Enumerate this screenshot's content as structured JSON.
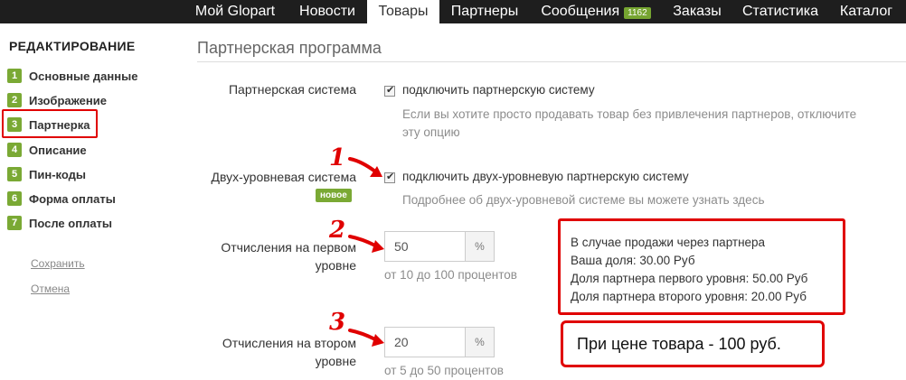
{
  "nav": [
    {
      "label": "Мой Glopart",
      "active": false
    },
    {
      "label": "Новости",
      "active": false
    },
    {
      "label": "Товары",
      "active": true
    },
    {
      "label": "Партнеры",
      "active": false
    },
    {
      "label": "Сообщения",
      "active": false,
      "badge": "1162"
    },
    {
      "label": "Заказы",
      "active": false
    },
    {
      "label": "Статистика",
      "active": false
    },
    {
      "label": "Каталог",
      "active": false
    }
  ],
  "sidebar": {
    "title": "РЕДАКТИРОВАНИЕ",
    "selected_index": 2,
    "items": [
      {
        "num": "1",
        "label": "Основные данные"
      },
      {
        "num": "2",
        "label": "Изображение"
      },
      {
        "num": "3",
        "label": "Партнерка"
      },
      {
        "num": "4",
        "label": "Описание"
      },
      {
        "num": "5",
        "label": "Пин-коды"
      },
      {
        "num": "6",
        "label": "Форма оплаты"
      },
      {
        "num": "7",
        "label": "После оплаты"
      }
    ],
    "save_label": "Сохранить",
    "cancel_label": "Отмена"
  },
  "main": {
    "section_title": "Партнерская программа",
    "partner_system": {
      "label": "Партнерская система",
      "checkbox_label": "подключить партнерскую систему",
      "checked": true,
      "help_line1": "Если вы хотите просто продавать товар без привлечения партнеров, отключите",
      "help_line2": "эту опцию"
    },
    "two_level": {
      "label": "Двух-уровневая система",
      "badge": "новое",
      "checkbox_label": "подключить двух-уровневую партнерскую систему",
      "checked": true,
      "help": "Подробнее об двух-уровневой системе вы можете узнать здесь"
    },
    "first_level": {
      "label_line1": "Отчисления на первом",
      "label_line2": "уровне",
      "value": "50",
      "addon": "%",
      "help": "от 10 до 100 процентов"
    },
    "second_level": {
      "label_line1": "Отчисления на втором",
      "label_line2": "уровне",
      "value": "20",
      "addon": "%",
      "help": "от 5 до 50 процентов"
    }
  },
  "annotations": {
    "numbers": [
      "1",
      "2",
      "3"
    ],
    "info_lines": [
      "В случае продажи через партнера",
      "Ваша доля: 30.00 Руб",
      "Доля партнера первого уровня: 50.00 Руб",
      "Доля партнера второго уровня: 20.00 Руб"
    ],
    "price_note": "При цене товара - 100 руб.",
    "color": "#e00000"
  },
  "colors": {
    "accent_green": "#7aa934",
    "topbar": "#1e1e1e",
    "highlight_red": "#e00000"
  }
}
